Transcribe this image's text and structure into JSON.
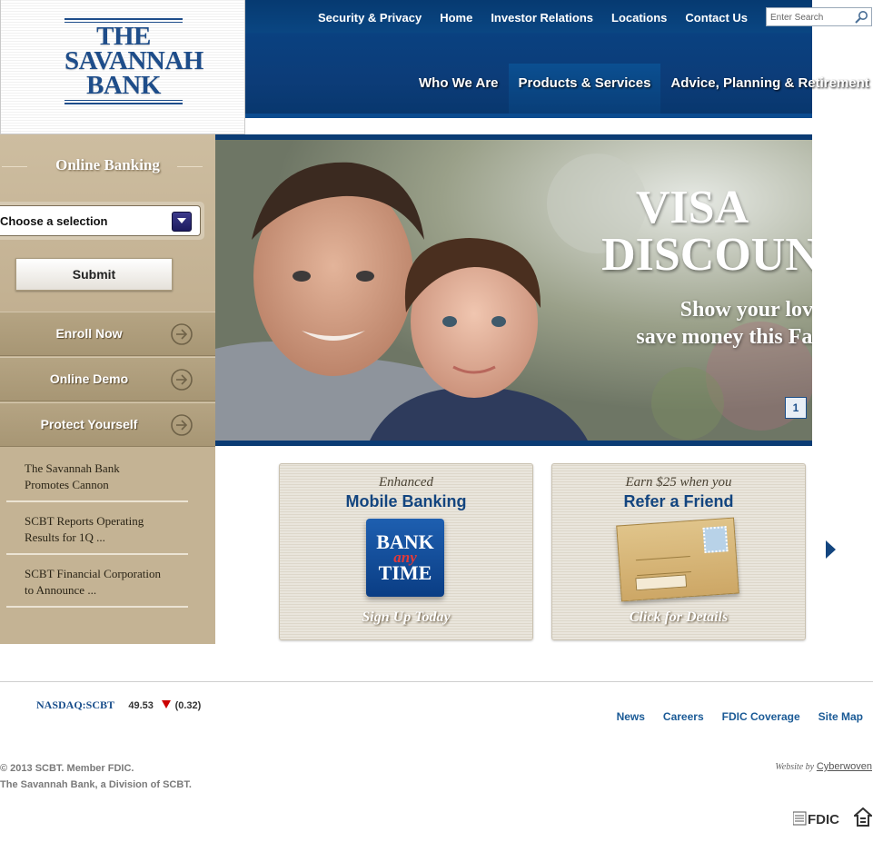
{
  "logo": {
    "line1": "THE",
    "line2": "SAVANNAH",
    "line3": "BANK"
  },
  "top_nav": [
    "Security & Privacy",
    "Home",
    "Investor Relations",
    "Locations",
    "Contact Us"
  ],
  "search": {
    "placeholder": "Enter Search"
  },
  "main_nav": [
    "Who We Are",
    "Products & Services",
    "Advice, Planning & Retirement"
  ],
  "sidebar": {
    "title": "Online Banking",
    "select_value": "Choose a selection",
    "submit_label": "Submit",
    "buttons": [
      "Enroll Now",
      "Online Demo",
      "Protect Yourself"
    ],
    "news": [
      {
        "line1": "The Savannah Bank",
        "line2": "Promotes Cannon"
      },
      {
        "line1": "SCBT Reports Operating",
        "line2": "Results for 1Q ..."
      },
      {
        "line1": "SCBT Financial Corporation",
        "line2": "to Announce ..."
      }
    ]
  },
  "hero": {
    "title_line1": "VISA",
    "title_line2": "DISCOUN",
    "sub_line1": "Show your love an",
    "sub_line2": "save money this Father",
    "slide_number": "1"
  },
  "cards": [
    {
      "kicker": "Enhanced",
      "headline": "Mobile Banking",
      "badge_top": "BANK",
      "badge_mid": "any",
      "badge_bottom": "TIME",
      "cta": "Sign Up Today"
    },
    {
      "kicker": "Earn $25 when you",
      "headline": "Refer a Friend",
      "cta": "Click for Details"
    }
  ],
  "ticker": {
    "symbol": "NASDAQ:SCBT",
    "price": "49.53",
    "change": "(0.32)",
    "direction": "down"
  },
  "footer_links": [
    "News",
    "Careers",
    "FDIC Coverage",
    "Site Map"
  ],
  "copyright": {
    "line1": "© 2013 SCBT. Member FDIC.",
    "line2": "The Savannah Bank, a Division of SCBT."
  },
  "credit": {
    "prefix": "Website by",
    "name": "Cyberwoven"
  },
  "badges": {
    "fdic": "FDIC"
  },
  "colors": {
    "navy": "#0a4180",
    "tan": "#c4b394",
    "link_blue": "#1a5a96",
    "down_red": "#cc0000"
  }
}
